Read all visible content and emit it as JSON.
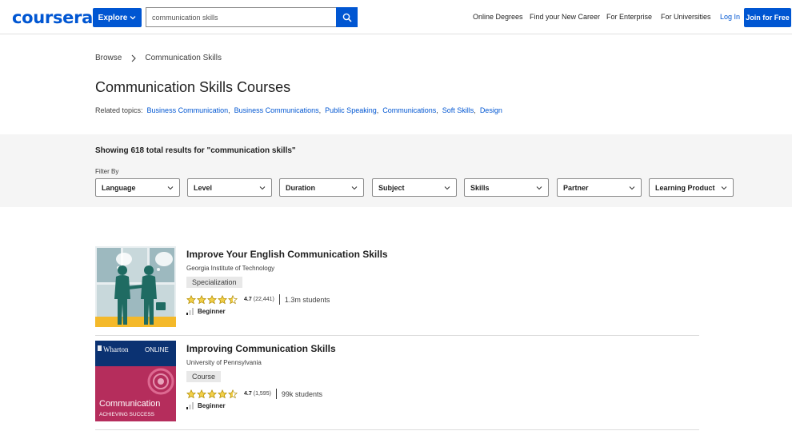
{
  "header": {
    "logo": "coursera",
    "explore_label": "Explore",
    "search_value": "communication skills",
    "nav": [
      "Online Degrees",
      "Find your New Career",
      "For Enterprise",
      "For Universities"
    ],
    "login_label": "Log In",
    "join_label": "Join for Free",
    "brand_color": "#0056d2"
  },
  "breadcrumb": {
    "root": "Browse",
    "current": "Communication Skills"
  },
  "page": {
    "title": "Communication Skills Courses",
    "related_label": "Related topics:",
    "related_topics": [
      "Business Communication",
      "Business Communications",
      "Public Speaking",
      "Communications",
      "Soft Skills",
      "Design"
    ]
  },
  "filters": {
    "results_text": "Showing 618 total results for \"communication skills\"",
    "filter_by_label": "Filter By",
    "dropdowns": [
      "Language",
      "Level",
      "Duration",
      "Subject",
      "Skills",
      "Partner",
      "Learning Product"
    ]
  },
  "results": [
    {
      "title": "Improve Your English Communication Skills",
      "partner": "Georgia Institute of Technology",
      "type": "Specialization",
      "rating": "4.7",
      "rating_count": "(22,441)",
      "stars": 4.5,
      "students": "1.3m students",
      "level": "Beginner"
    },
    {
      "title": "Improving Communication Skills",
      "partner": "University of Pennsylvania",
      "type": "Course",
      "rating": "4.7",
      "rating_count": "(1,595)",
      "stars": 4.5,
      "students": "99k students",
      "level": "Beginner",
      "thumb_text": {
        "brand": "Wharton",
        "online": "ONLINE",
        "subject": "Communication",
        "tagline": "ACHIEVING SUCCESS"
      }
    }
  ]
}
